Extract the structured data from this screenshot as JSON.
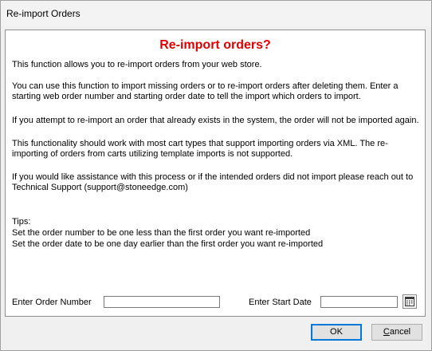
{
  "window": {
    "title": "Re-import Orders"
  },
  "content": {
    "heading": "Re-import orders?",
    "paragraphs": [
      "This function allows you to re-import orders from your web store.",
      "You can use this function to import missing orders or to re-import orders after deleting them. Enter a starting web order number and starting order date to tell the import which orders to import.",
      "If you attempt to re-import an order that already exists in the system, the order will not be imported again.",
      "This functionality should work with most cart types that support importing orders via XML.  The re-importing of orders from carts utilizing template imports is not supported.",
      "If you would like assistance with this process or if the intended orders did not import please reach out to Technical Support (support@stoneedge.com)"
    ],
    "tips_title": "Tips:",
    "tips": [
      "Set the order number to be one less than the first order you want re-imported",
      "Set the order date to be one day earlier than the first order you want re-imported"
    ]
  },
  "form": {
    "order_number_label": "Enter Order Number",
    "order_number_value": "",
    "start_date_label": "Enter Start Date",
    "start_date_value": "",
    "calendar_icon": "calendar-icon"
  },
  "buttons": {
    "ok_label": "OK",
    "cancel_label": "Cancel"
  },
  "colors": {
    "heading": "#e40000",
    "default_button_border": "#0078d7"
  }
}
